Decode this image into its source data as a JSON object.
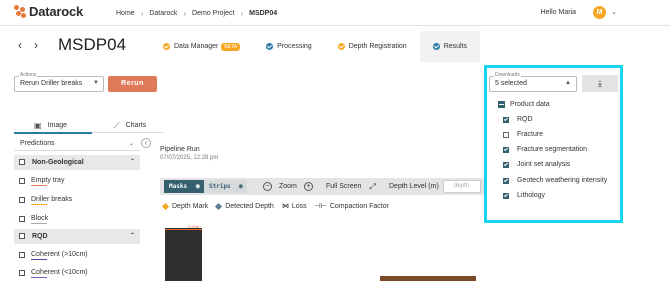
{
  "app": {
    "logo_text": "Datarock"
  },
  "breadcrumb": [
    "Home",
    "Datarock",
    "Demo Project",
    "MSDP04"
  ],
  "user": {
    "greeting": "Hello Maria",
    "initial": "M"
  },
  "page": {
    "title": "MSDP04"
  },
  "tabs": [
    {
      "label": "Data Manager",
      "badge": "BETA"
    },
    {
      "label": "Processing"
    },
    {
      "label": "Depth Registration"
    },
    {
      "label": "Results"
    }
  ],
  "actions": {
    "label": "Actions",
    "value": "Rerun Driller breaks",
    "rerun_label": "Rerun"
  },
  "subtabs": {
    "image": "Image",
    "charts": "Charts"
  },
  "predictions": {
    "label": "Predictions"
  },
  "groups": {
    "non_geological": {
      "title": "Non-Geological",
      "items": [
        {
          "label": "Empty tray",
          "color": "#e07b5a"
        },
        {
          "label": "Driller breaks",
          "color": "#f5a623"
        },
        {
          "label": "Block",
          "color": "#aaaaaa"
        }
      ]
    },
    "rqd": {
      "title": "RQD",
      "items": [
        {
          "label": "Coherent (>10cm)",
          "color": "#5b3fa8"
        },
        {
          "label": "Coherent (<10cm)",
          "color": "#7b5fc8"
        }
      ]
    }
  },
  "run": {
    "title": "Pipeline Run",
    "date": "07/07/2025, 12:28 pm"
  },
  "toolbar": {
    "masks": "Masks",
    "strips": "Strips",
    "zoom": "Zoom",
    "fullscreen": "Full Screen",
    "depth_level": "Depth Level (m)",
    "depth_placeholder": "depth"
  },
  "legend": {
    "depth_mark": "Depth Mark",
    "detected_depth": "Detected Depth",
    "loss": "Loss",
    "compaction": "Compaction Factor"
  },
  "core": {
    "depth_label": "0.00m"
  },
  "downloads": {
    "label": "Downloads",
    "value": "5 selected",
    "group": "Product data",
    "items": [
      {
        "label": "RQD",
        "checked": true
      },
      {
        "label": "Fracture",
        "checked": false
      },
      {
        "label": "Fracture segmentation",
        "checked": true
      },
      {
        "label": "Joint set analysis",
        "checked": true
      },
      {
        "label": "Geotech weathering intensity",
        "checked": true
      },
      {
        "label": "Lithology",
        "checked": true
      }
    ]
  },
  "colors": {
    "accent": "#2d7aa8",
    "rerun": "#e07b5a",
    "highlight": "#19d3f0",
    "masks": "#35606f"
  }
}
